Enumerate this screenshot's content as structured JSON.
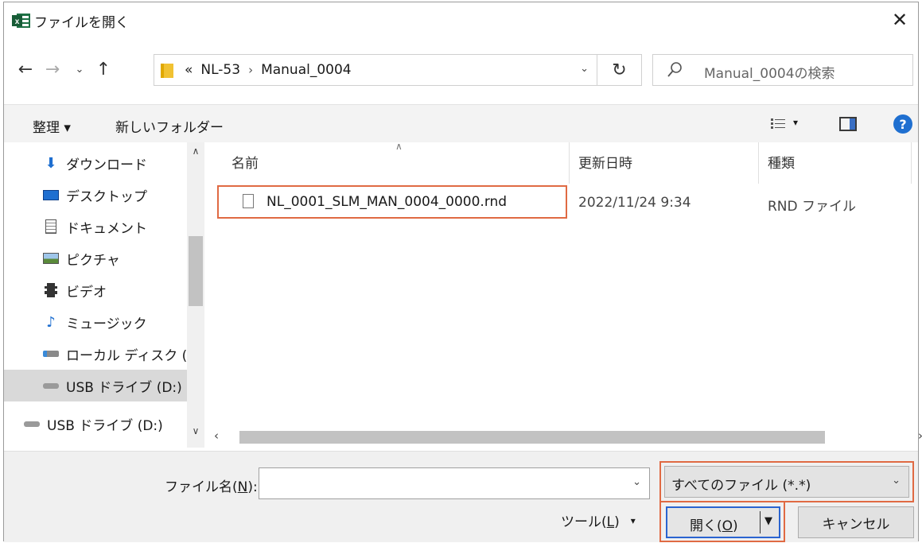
{
  "window": {
    "title": "ファイルを開く",
    "app_icon": "excel-icon",
    "close_glyph": "✕"
  },
  "nav": {
    "back_glyph": "←",
    "forward_glyph": "→",
    "recent_glyph": "⌄",
    "up_glyph": "↑",
    "breadcrumb_overflow": "«",
    "breadcrumbs": [
      "NL-53",
      "Manual_0004"
    ],
    "breadcrumb_sep": "›",
    "refresh_glyph": "↻",
    "search_placeholder": "Manual_0004の検索"
  },
  "toolbar": {
    "organize_label": "整理 ▾",
    "new_folder_label": "新しいフォルダー",
    "view_drop": "▾",
    "help_label": "?"
  },
  "sidebar": {
    "items": [
      {
        "label": "ダウンロード",
        "icon": "download-icon"
      },
      {
        "label": "デスクトップ",
        "icon": "desktop-icon"
      },
      {
        "label": "ドキュメント",
        "icon": "document-icon"
      },
      {
        "label": "ピクチャ",
        "icon": "pictures-icon"
      },
      {
        "label": "ビデオ",
        "icon": "video-icon"
      },
      {
        "label": "ミュージック",
        "icon": "music-icon"
      },
      {
        "label": "ローカル ディスク (",
        "icon": "local-disk-icon"
      },
      {
        "label": "USB ドライブ (D:)",
        "icon": "usb-drive-icon",
        "selected": true
      },
      {
        "label": "USB ドライブ (D:)",
        "icon": "usb-drive-icon"
      }
    ]
  },
  "filelist": {
    "columns": [
      "名前",
      "更新日時",
      "種類"
    ],
    "files": [
      {
        "name": "NL_0001_SLM_MAN_0004_0000.rnd",
        "modified": "2022/11/24 9:34",
        "type": "RND ファイル"
      }
    ]
  },
  "footer": {
    "filename_label_pre": "ファイル名(",
    "filename_label_key": "N",
    "filename_label_post": "):",
    "filename_value": "",
    "filter_value": "すべてのファイル (*.*)",
    "tools_label_pre": "ツール(",
    "tools_label_key": "L",
    "tools_label_post": ")",
    "open_label_pre": "開く(",
    "open_label_key": "O",
    "open_label_post": ")",
    "cancel_label": "キャンセル"
  },
  "colors": {
    "highlight_border": "#e06a43",
    "accent": "#2a64d0"
  }
}
